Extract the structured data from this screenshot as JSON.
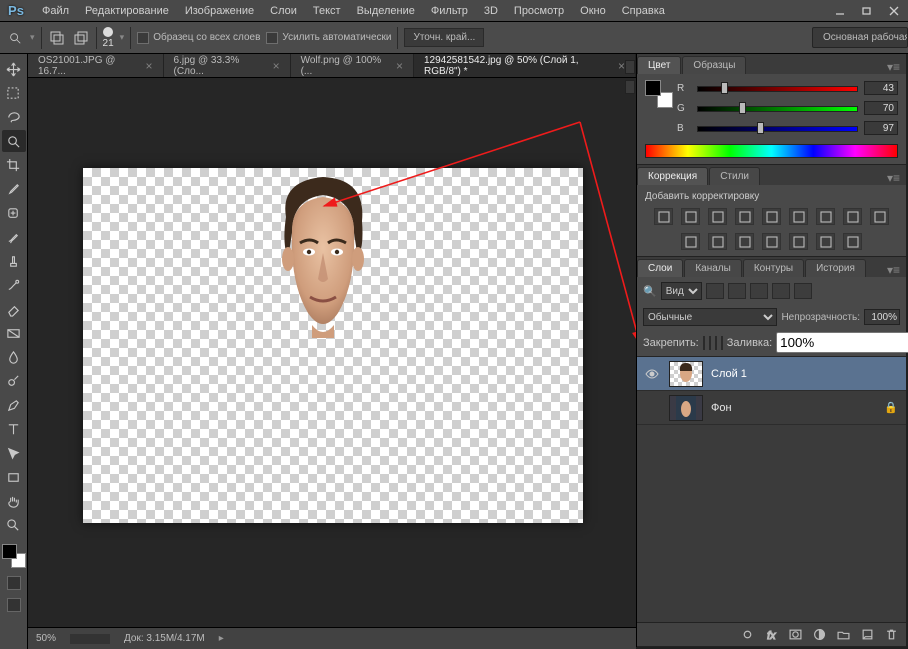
{
  "app": {
    "logo": "Ps"
  },
  "menu": [
    "Файл",
    "Редактирование",
    "Изображение",
    "Слои",
    "Текст",
    "Выделение",
    "Фильтр",
    "3D",
    "Просмотр",
    "Окно",
    "Справка"
  ],
  "options": {
    "brush_size": "21",
    "sample_all_label": "Образец со всех слоев",
    "auto_enhance_label": "Усилить автоматически",
    "refine_edge_label": "Уточн. край...",
    "workspace_label": "Основная рабочая сред"
  },
  "tabs": [
    {
      "label": "OS21001.JPG @ 16.7...",
      "active": false
    },
    {
      "label": "6.jpg @ 33.3% (Сло...",
      "active": false
    },
    {
      "label": "Wolf.png @ 100% (...",
      "active": false
    },
    {
      "label": "12942581542.jpg @ 50% (Слой 1, RGB/8\")  *",
      "active": true
    }
  ],
  "tools": [
    "move",
    "marquee",
    "lasso",
    "quick-select",
    "crop",
    "eyedropper",
    "healing",
    "brush",
    "stamp",
    "history-brush",
    "eraser",
    "gradient",
    "blur",
    "dodge",
    "pen",
    "type",
    "path-select",
    "rectangle",
    "hand",
    "zoom"
  ],
  "color_panel": {
    "tabs": [
      "Цвет",
      "Образцы"
    ],
    "r": 43,
    "g": 70,
    "b": 97
  },
  "adjustments": {
    "tabs": [
      "Коррекция",
      "Стили"
    ],
    "title": "Добавить корректировку"
  },
  "layers_panel": {
    "tabs": [
      "Слои",
      "Каналы",
      "Контуры",
      "История"
    ],
    "kind_label": "Вид",
    "blend_mode": "Обычные",
    "opacity_label": "Непрозрачность:",
    "opacity_value": "100%",
    "lock_label": "Закрепить:",
    "fill_label": "Заливка:",
    "fill_value": "100%",
    "layers": [
      {
        "name": "Слой 1",
        "selected": true,
        "visible": true,
        "locked": false,
        "thumb": "face"
      },
      {
        "name": "Фон",
        "selected": false,
        "visible": false,
        "locked": true,
        "thumb": "bg"
      }
    ]
  },
  "status": {
    "zoom": "50%",
    "doc_info": "Док:  3.15M/4.17M"
  }
}
